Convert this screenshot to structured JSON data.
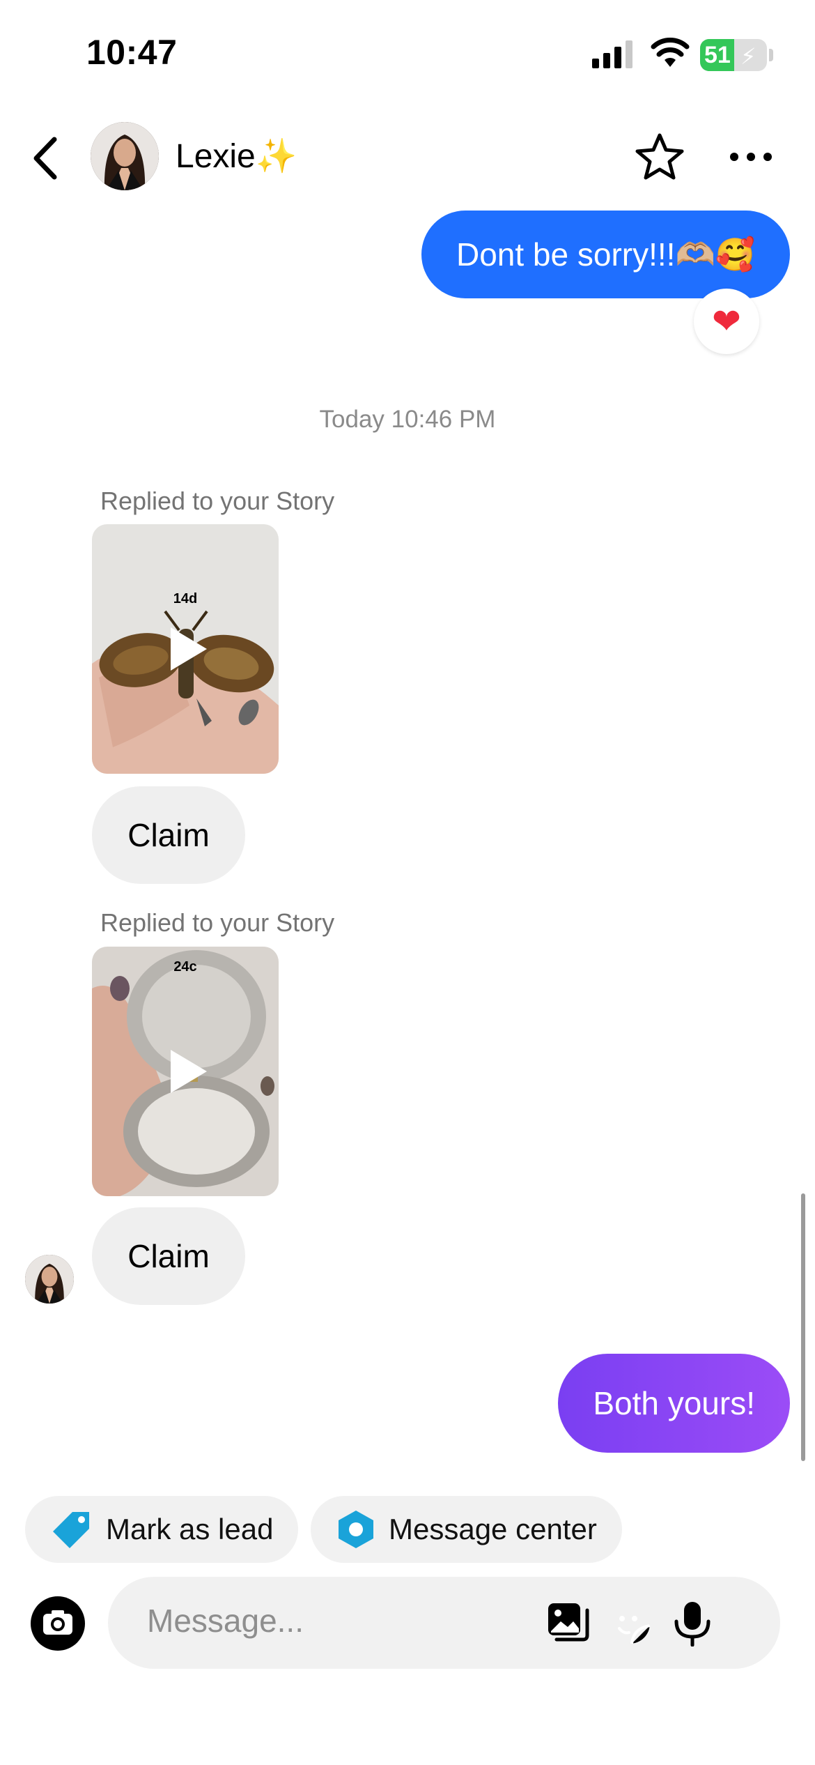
{
  "status_bar": {
    "time": "10:47",
    "battery_pct": "51",
    "battery_level": 0.51
  },
  "header": {
    "contact_name": "Lexie",
    "contact_emoji": "✨"
  },
  "messages": {
    "sent_1": {
      "text": "Dont be sorry!!!🫶🏼🥰",
      "reaction": "❤"
    },
    "timestamp": "Today 10:46 PM",
    "story_1": {
      "label": "Replied to your Story",
      "duration": "14d",
      "reply": "Claim"
    },
    "story_2": {
      "label": "Replied to your Story",
      "duration": "24c",
      "reply": "Claim"
    },
    "sent_2": {
      "text": "Both yours!"
    }
  },
  "chips": {
    "mark_lead": "Mark as lead",
    "message_center": "Message center"
  },
  "composer": {
    "placeholder": "Message..."
  },
  "colors": {
    "sent_bubble": "#1f6fff",
    "purple_bubble": "#8a45f5",
    "tag_icon": "#1aa3d9"
  }
}
